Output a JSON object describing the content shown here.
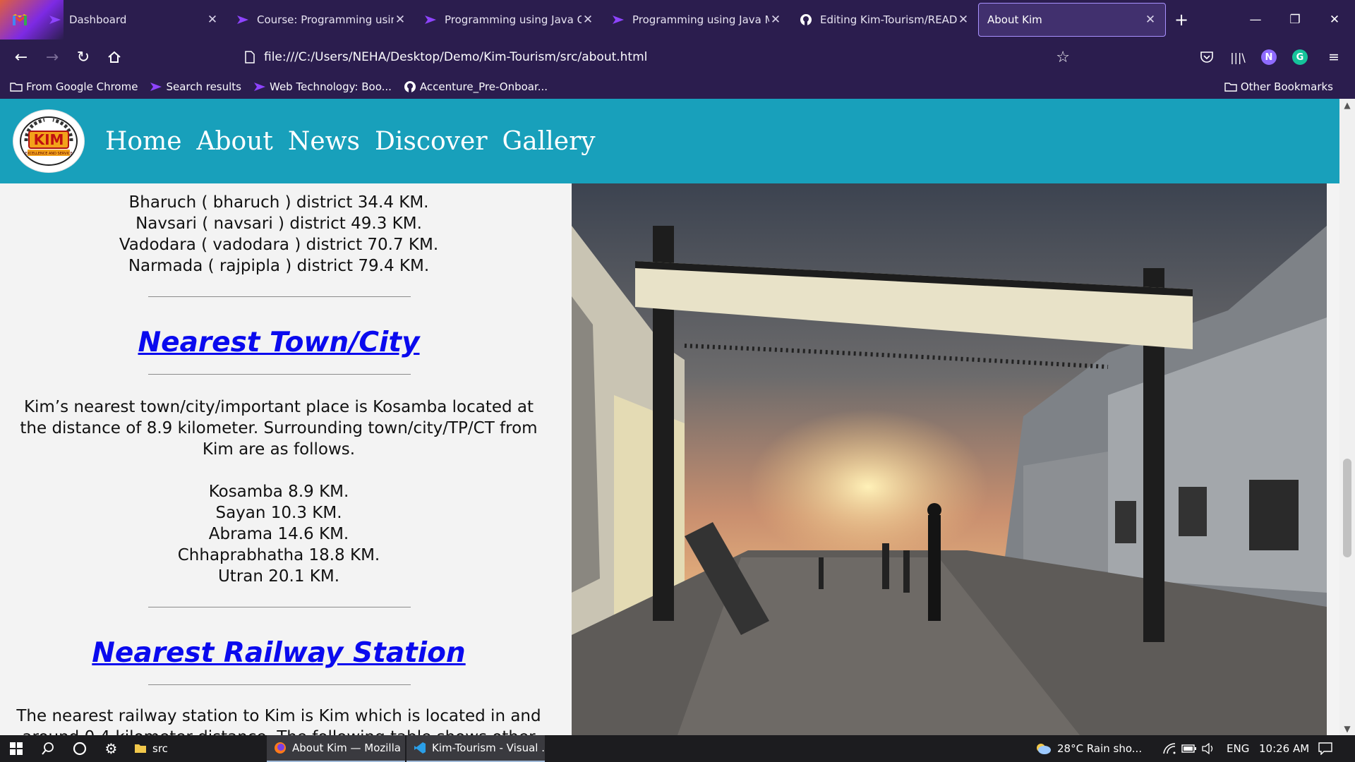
{
  "browser": {
    "tabs": [
      {
        "title": "Dashboard",
        "icon": "gmail-icon"
      },
      {
        "title": "Course: Programming using J",
        "icon": "course-icon"
      },
      {
        "title": "Programming using Java Con",
        "icon": "course-icon"
      },
      {
        "title": "Programming using Java Mo",
        "icon": "course-icon"
      },
      {
        "title": "Editing Kim-Tourism/READM",
        "icon": "github-icon"
      },
      {
        "title": "About Kim",
        "icon": "page-icon",
        "active": true
      }
    ],
    "url": "file:///C:/Users/NEHA/Desktop/Demo/Kim-Tourism/src/about.html",
    "bookmarks": [
      "From Google Chrome",
      "Search results",
      "Web Technology: Boo...",
      "Accenture_Pre-Onboar..."
    ],
    "other_bookmarks": "Other Bookmarks",
    "profile_initial": "N",
    "extension_initial": "G"
  },
  "site": {
    "logo_text": "KIM",
    "logo_subtext": "EXCELLENCE AND SERVICE",
    "nav": [
      "Home",
      "About",
      "News",
      "Discover",
      "Gallery"
    ],
    "districts": [
      "Bharuch ( bharuch ) district 34.4 KM.",
      "Navsari ( navsari ) district 49.3 KM.",
      "Vadodara ( vadodara ) district 70.7 KM.",
      "Narmada ( rajpipla ) district 79.4 KM."
    ],
    "town_heading": "Nearest Town/City",
    "town_paragraph": "Kim’s nearest town/city/important place is Kosamba located at the distance of 8.9 kilometer. Surrounding town/city/TP/CT from Kim are as follows.",
    "towns": [
      "Kosamba 8.9 KM.",
      "Sayan 10.3 KM.",
      "Abrama 14.6 KM.",
      "Chhaprabhatha 18.8 KM.",
      "Utran 20.1 KM."
    ],
    "railway_heading": "Nearest Railway Station",
    "railway_paragraph": "The nearest railway station to Kim is Kim which is located in and around 0.4 kilometer distance. The following table shows other"
  },
  "taskbar": {
    "apps": [
      {
        "label": "src",
        "icon": "folder-icon"
      },
      {
        "label": "About Kim — Mozilla ...",
        "icon": "firefox-icon",
        "open": true
      },
      {
        "label": "Kim-Tourism - Visual ...",
        "icon": "vscode-icon",
        "open": true
      }
    ],
    "weather": "28°C  Rain sho...",
    "language": "ENG",
    "time": "10:26 AM"
  },
  "colors": {
    "chrome_bg": "#2b1d4e",
    "active_tab_border": "#a991ff",
    "site_header": "#18a0bb",
    "heading_link": "#0a0aee",
    "taskbar": "#1c1c1f"
  }
}
